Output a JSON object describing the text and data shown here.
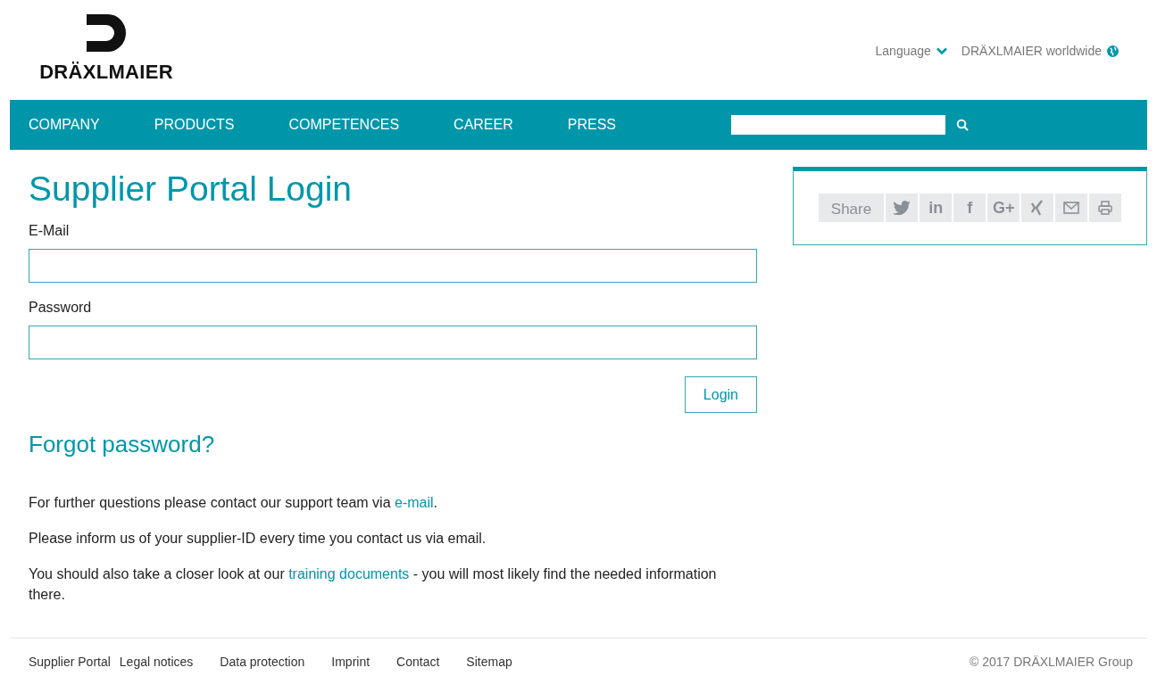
{
  "header": {
    "logo_text": "DRÄXLMAIER",
    "language": "Language",
    "worldwide": "DRÄXLMAIER worldwide"
  },
  "nav": {
    "items": [
      "COMPANY",
      "PRODUCTS",
      "COMPETENCES",
      "CAREER",
      "PRESS"
    ]
  },
  "title": "Supplier Portal Login",
  "fields": [
    {
      "label": "E-Mail"
    },
    {
      "label": "Password"
    }
  ],
  "login_button": "Login",
  "forgot": "Forgot password?",
  "paragraphs": [
    {
      "before": "For further questions please contact our support team via ",
      "link": "e-mail",
      "after": "."
    },
    {
      "before": "Please inform us of your supplier-ID every time you contact us via email."
    },
    {
      "before": "You should also take a closer look at our ",
      "link": "training documents",
      "after": " - you will most likely find the needed information there."
    }
  ],
  "share": {
    "label": "Share",
    "items": [
      {
        "kind": "twitter"
      },
      {
        "kind": "text",
        "text": "in"
      },
      {
        "kind": "text",
        "text": "f"
      },
      {
        "kind": "text",
        "text": "G+"
      },
      {
        "kind": "xing"
      },
      {
        "kind": "mail"
      },
      {
        "kind": "print"
      }
    ]
  },
  "footer": {
    "links": [
      "Supplier Portal",
      "Legal notices",
      "Data protection",
      "Imprint",
      "Contact",
      "Sitemap"
    ],
    "copyright": "© 2017 DRÄXLMAIER Group"
  }
}
